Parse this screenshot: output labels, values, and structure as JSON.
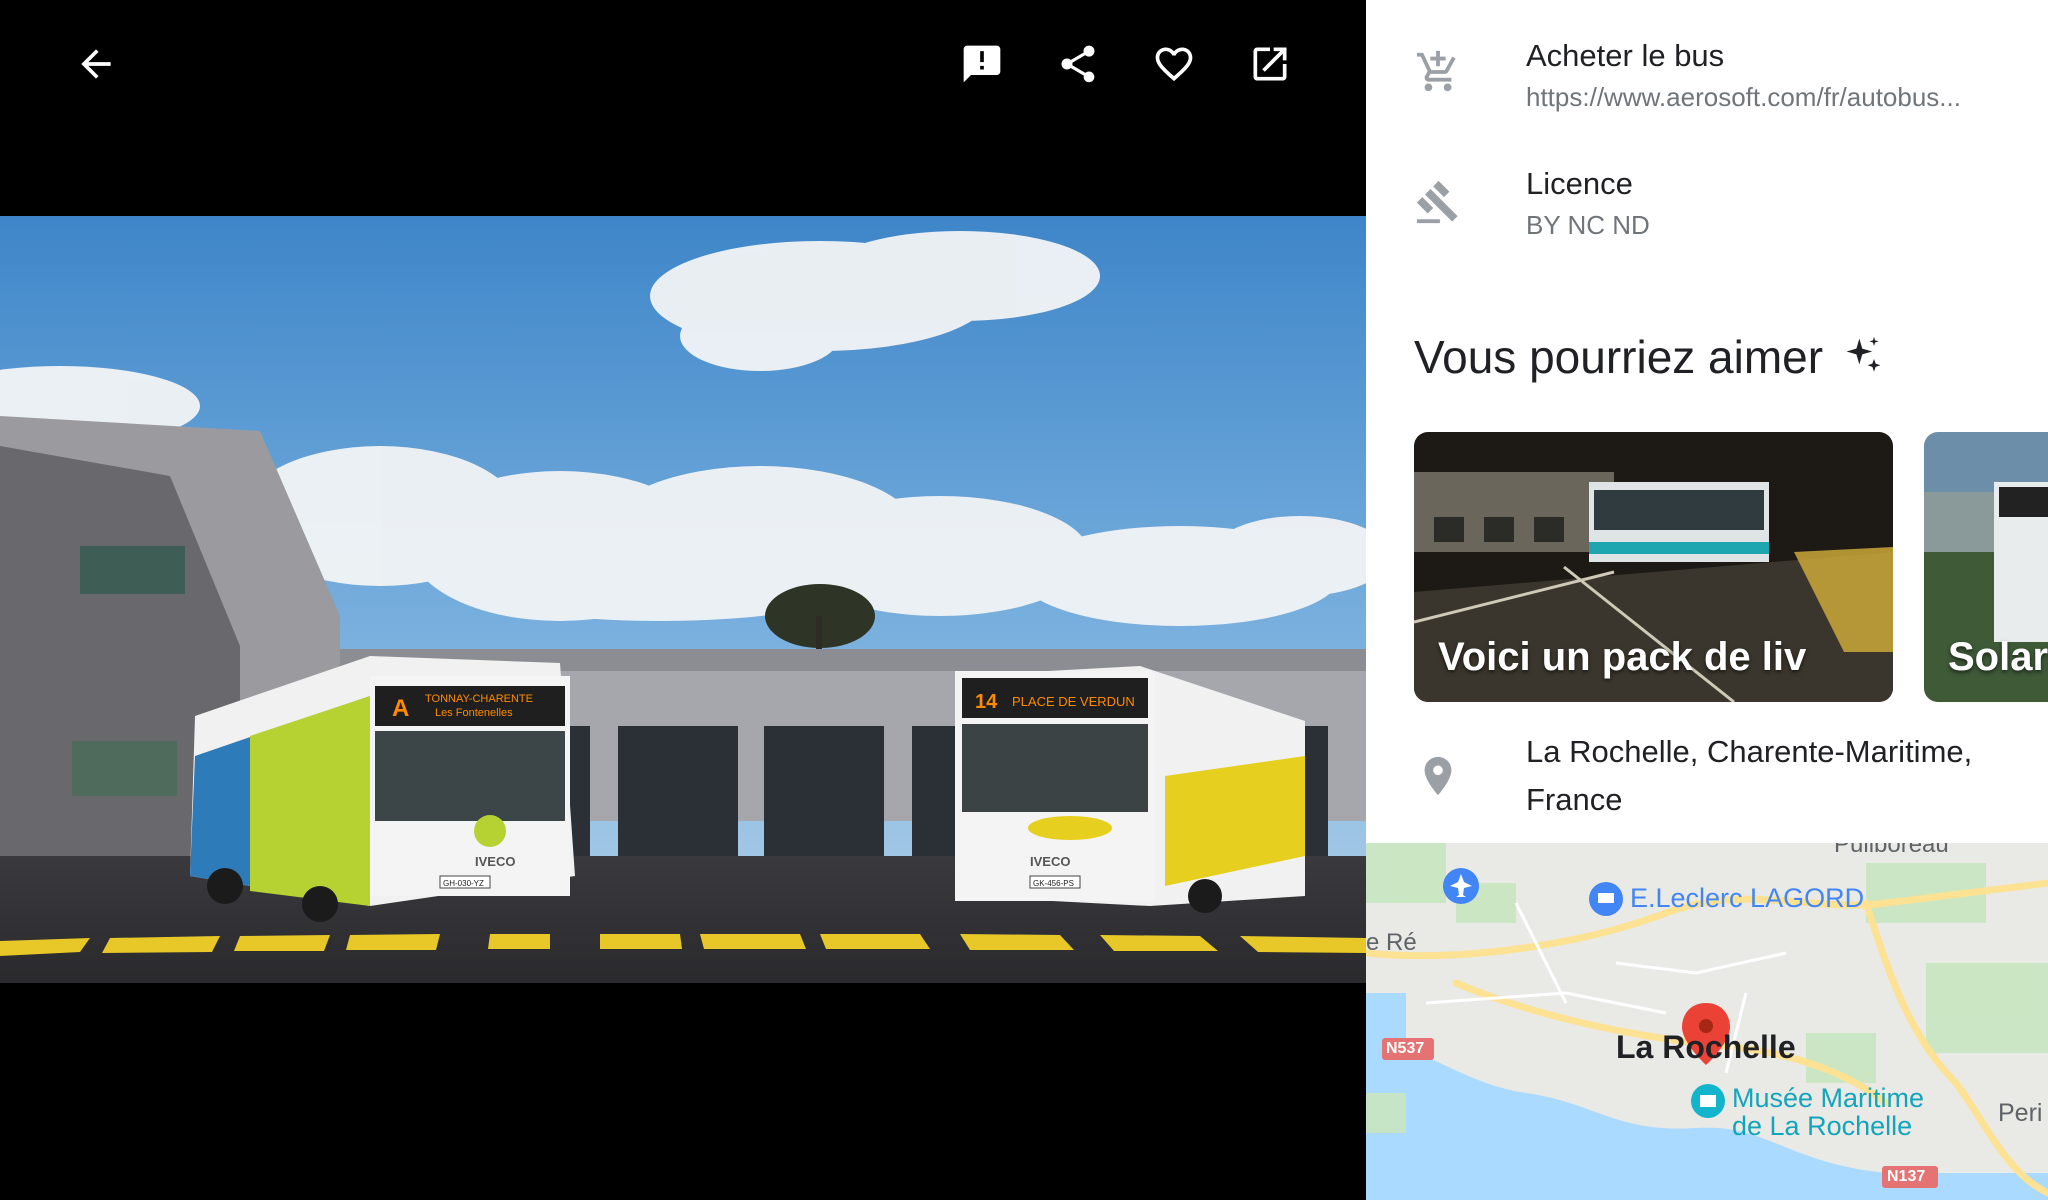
{
  "viewer": {
    "icons": {
      "back": "arrow-back-icon",
      "report": "report-icon",
      "share": "share-icon",
      "favorite": "heart-icon",
      "open": "open-in-new-icon"
    },
    "photo": {
      "bus_left": {
        "destination_letter": "A",
        "destination_line1": "TONNAY-CHARENTE",
        "destination_line2": "Les Fontenelles",
        "brand": "IVECO",
        "plate": "GH-030-YZ",
        "logo": "yelo"
      },
      "bus_right": {
        "route_number": "14",
        "destination": "PLACE DE VERDUN",
        "brand": "IVECO",
        "plate": "GK-456-PS",
        "logo": "yelo"
      }
    }
  },
  "info": {
    "buy": {
      "title": "Acheter le bus",
      "link": "https://www.aerosoft.com/fr/autobus...",
      "icon": "add-shopping-cart-icon"
    },
    "license": {
      "title": "Licence",
      "value": "BY NC ND",
      "icon": "gavel-icon"
    }
  },
  "recommendations": {
    "title": "Vous pourriez aimer",
    "icon": "sparkle-icon",
    "cards": [
      {
        "label": "Voici un pack de liv"
      },
      {
        "label": "Solari"
      }
    ]
  },
  "location": {
    "text": "La Rochelle, Charente-Maritime, France",
    "icon": "place-pin-icon"
  },
  "map": {
    "labels": {
      "town_top": "Puilboreau",
      "store": "E.Leclerc LAGORD",
      "island": "e Ré",
      "road_west": "N537",
      "city": "La Rochelle",
      "museum_line1": "Musée Maritime",
      "museum_line2": "de La Rochelle",
      "east": "Peri",
      "road_south": "N137"
    },
    "colors": {
      "sea": "#aadaff",
      "road": "#fde293",
      "land": "#e9e9e6",
      "park": "#c8e6c0",
      "pin": "#ea4335"
    }
  }
}
